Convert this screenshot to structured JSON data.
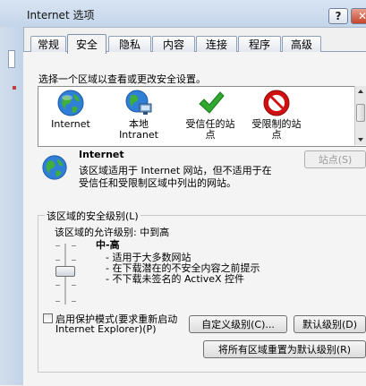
{
  "window": {
    "title": "Internet 选项",
    "help_label": "?",
    "close_label": "✕"
  },
  "tabs": [
    {
      "label": "常规"
    },
    {
      "label": "安全"
    },
    {
      "label": "隐私"
    },
    {
      "label": "内容"
    },
    {
      "label": "连接"
    },
    {
      "label": "程序"
    },
    {
      "label": "高级"
    }
  ],
  "active_tab": "安全",
  "instruction": "选择一个区域以查看或更改安全设置。",
  "zones": [
    {
      "label_line1": "Internet",
      "label_line2": "",
      "icon": "globe-icon"
    },
    {
      "label_line1": "本地",
      "label_line2": "Intranet",
      "icon": "intranet-icon"
    },
    {
      "label_line1": "受信任的站",
      "label_line2": "点",
      "icon": "check-icon"
    },
    {
      "label_line1": "受限制的站",
      "label_line2": "点",
      "icon": "no-entry-icon"
    }
  ],
  "selected_zone": {
    "title": "Internet",
    "description_line1": "该区域适用于 Internet 网站，但不适用于在",
    "description_line2": "受信任和受限制区域中列出的网站。"
  },
  "sites_button_label": "站点(S)",
  "security_level": {
    "group_label": "该区域的安全级别(L)",
    "allowed_label": "该区域的允许级别: 中到高",
    "level_name": "中-高",
    "bullets": [
      "- 适用于大多数网站",
      "- 在下载潜在的不安全内容之前提示",
      "- 不下载未签名的 ActiveX 控件"
    ]
  },
  "protected_mode": {
    "label_line1": "启用保护模式(要求重新启动",
    "label_line2": "Internet Explorer)(P)",
    "checked": false
  },
  "buttons": {
    "custom_level": "自定义级别(C)...",
    "default_level": "默认级别(D)",
    "reset_all": "将所有区域重置为默认级别(R)"
  },
  "colors": {
    "titlebar": "#c4d5ea",
    "close_button": "#c7432a",
    "check_green": "#2fa82f",
    "no_entry_red": "#d01010"
  }
}
